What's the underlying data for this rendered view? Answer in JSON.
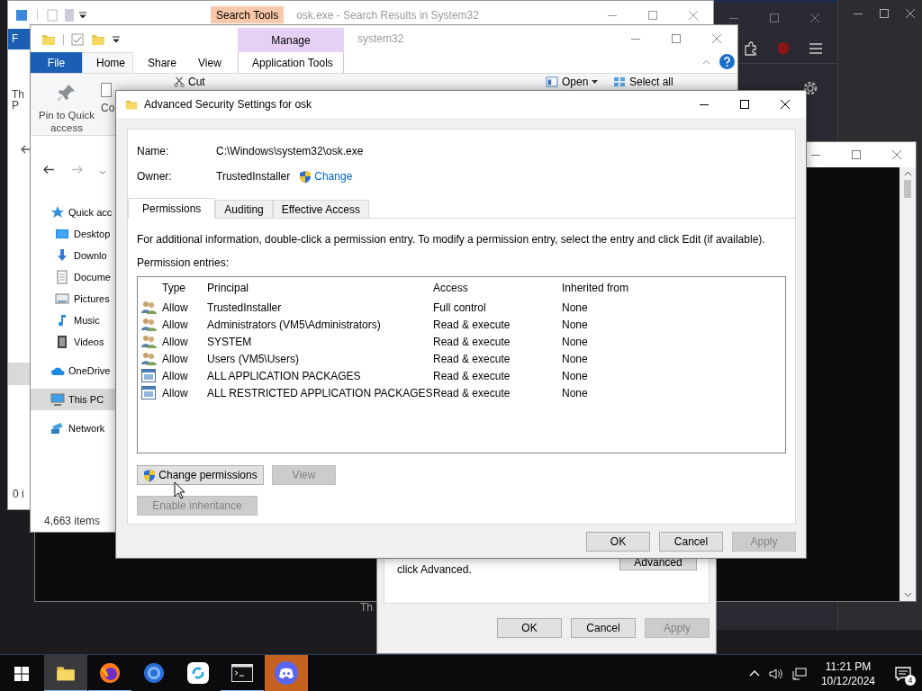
{
  "search_window": {
    "context_tab": "Search Tools",
    "title": "osk.exe - Search Results in System32",
    "file_tab": "F",
    "ribbon_fragments": [
      "Th",
      "P"
    ],
    "status_fragment": "0 i"
  },
  "explorer_window": {
    "context_tab": "Manage",
    "title": "system32",
    "tabs": [
      {
        "label": "File",
        "kind": "file",
        "selected": false
      },
      {
        "label": "Home",
        "kind": "tab",
        "selected": true
      },
      {
        "label": "Share",
        "kind": "tab",
        "selected": false
      },
      {
        "label": "View",
        "kind": "tab",
        "selected": false
      },
      {
        "label": "Application Tools",
        "kind": "tab",
        "selected": false
      }
    ],
    "ribbon": [
      {
        "kind": "large",
        "label": "Pin to Quick access"
      },
      {
        "kind": "large",
        "label": "Co"
      },
      {
        "kind": "small",
        "label": "Cut"
      },
      {
        "kind": "dropdown",
        "label": "Open"
      },
      {
        "kind": "small",
        "label": "Select all"
      }
    ],
    "nav": [
      {
        "kind": "star",
        "label": "Quick acc",
        "selected": false,
        "children": [
          {
            "kind": "desktop",
            "label": "Desktop",
            "selected": false
          },
          {
            "kind": "download",
            "label": "Downlo",
            "selected": false
          },
          {
            "kind": "document",
            "label": "Docume",
            "selected": false
          },
          {
            "kind": "pictures",
            "label": "Pictures",
            "selected": false
          },
          {
            "kind": "music",
            "label": "Music",
            "selected": false
          },
          {
            "kind": "video",
            "label": "Videos",
            "selected": false
          }
        ]
      },
      {
        "kind": "cloud",
        "label": "OneDrive",
        "selected": false
      },
      {
        "kind": "pc",
        "label": "This PC",
        "selected": true
      },
      {
        "kind": "network",
        "label": "Network",
        "selected": false
      }
    ],
    "status": "4,663 items"
  },
  "properties_dialog": {
    "text": "click Advanced.",
    "advanced_button": "Advanced",
    "buttons": [
      {
        "label": "OK",
        "disabled": false
      },
      {
        "label": "Cancel",
        "disabled": false
      },
      {
        "label": "Apply",
        "disabled": true
      }
    ]
  },
  "desktop_fragment": "Th",
  "security_dialog": {
    "title": "Advanced Security Settings for osk",
    "name_label": "Name:",
    "name_value": "C:\\Windows\\system32\\osk.exe",
    "owner_label": "Owner:",
    "owner_value": "TrustedInstaller",
    "change_link": "Change",
    "tabs": [
      {
        "label": "Permissions",
        "selected": true
      },
      {
        "label": "Auditing",
        "selected": false
      },
      {
        "label": "Effective Access",
        "selected": false
      }
    ],
    "info": "For additional information, double-click a permission entry. To modify a permission entry, select the entry and click Edit (if available).",
    "entries_label": "Permission entries:",
    "columns": [
      "Type",
      "Principal",
      "Access",
      "Inherited from"
    ],
    "rows": [
      {
        "kind": "group",
        "type": "Allow",
        "principal": "TrustedInstaller",
        "access": "Full control",
        "inherited": "None"
      },
      {
        "kind": "group",
        "type": "Allow",
        "principal": "Administrators (VM5\\Administrators)",
        "access": "Read & execute",
        "inherited": "None"
      },
      {
        "kind": "group",
        "type": "Allow",
        "principal": "SYSTEM",
        "access": "Read & execute",
        "inherited": "None"
      },
      {
        "kind": "group",
        "type": "Allow",
        "principal": "Users (VM5\\Users)",
        "access": "Read & execute",
        "inherited": "None"
      },
      {
        "kind": "package",
        "type": "Allow",
        "principal": "ALL APPLICATION PACKAGES",
        "access": "Read & execute",
        "inherited": "None"
      },
      {
        "kind": "package",
        "type": "Allow",
        "principal": "ALL RESTRICTED APPLICATION PACKAGES",
        "access": "Read & execute",
        "inherited": "None"
      }
    ],
    "change_permissions": {
      "label": "Change permissions",
      "disabled": false
    },
    "view": {
      "label": "View",
      "disabled": true
    },
    "enable_inheritance": {
      "label": "Enable inheritance",
      "disabled": true
    },
    "buttons": [
      {
        "label": "OK",
        "disabled": false
      },
      {
        "label": "Cancel",
        "disabled": false
      },
      {
        "label": "Apply",
        "disabled": true
      }
    ]
  },
  "taskbar": {
    "apps": [
      {
        "kind": "folder",
        "selected": true,
        "running": true,
        "flashing": false
      },
      {
        "kind": "globe",
        "selected": false,
        "running": true,
        "flashing": false
      },
      {
        "kind": "circle",
        "selected": false,
        "running": false,
        "flashing": false
      },
      {
        "kind": "sync",
        "selected": false,
        "running": false,
        "flashing": false
      },
      {
        "kind": "terminal",
        "selected": false,
        "running": true,
        "flashing": false
      },
      {
        "kind": "gamepad",
        "selected": false,
        "running": false,
        "flashing": true
      }
    ],
    "time": "11:21 PM",
    "date": "10/12/2024",
    "notification_count": "4"
  }
}
